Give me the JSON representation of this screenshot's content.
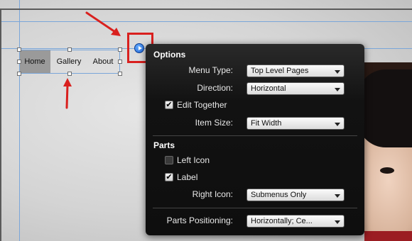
{
  "menu": {
    "items": [
      {
        "label": "Home",
        "active": true
      },
      {
        "label": "Gallery",
        "active": false
      },
      {
        "label": "About",
        "active": false
      }
    ]
  },
  "panel": {
    "options_title": "Options",
    "rows": {
      "menu_type": {
        "label": "Menu Type:",
        "value": "Top Level Pages"
      },
      "direction": {
        "label": "Direction:",
        "value": "Horizontal"
      },
      "edit_together": {
        "label": "Edit Together",
        "checked": true
      },
      "item_size": {
        "label": "Item Size:",
        "value": "Fit Width"
      }
    },
    "parts_title": "Parts",
    "parts": {
      "left_icon": {
        "label": "Left Icon",
        "checked": false
      },
      "label": {
        "label": "Label",
        "checked": true
      },
      "right_icon": {
        "label": "Right Icon:",
        "value": "Submenus Only"
      },
      "parts_positioning": {
        "label": "Parts Positioning:",
        "value": "Horizontally; Ce..."
      }
    }
  },
  "colors": {
    "callout_red": "#d9201e",
    "guide_blue": "#7aa6d9",
    "panel_bg": "#121212",
    "options_button": "#1d63d6"
  },
  "icons": [
    "options-arrow-icon",
    "checkmark-icon",
    "dropdown-arrow-icon",
    "red-arrow-icon"
  ]
}
